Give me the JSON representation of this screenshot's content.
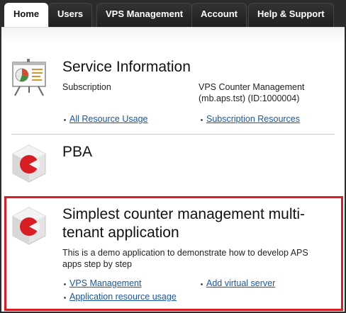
{
  "tabs": [
    {
      "label": "Home"
    },
    {
      "label": "Users"
    },
    {
      "label": "VPS Management"
    },
    {
      "label": "Account"
    },
    {
      "label": "Help & Support"
    }
  ],
  "service_info": {
    "title": "Service Information",
    "subscription_label": "Subscription",
    "subscription_value_line1": "VPS Counter Management",
    "subscription_value_line2": "(mb.aps.tst) (ID:1000004)",
    "links": [
      "All Resource Usage",
      "Subscription Resources"
    ]
  },
  "pba": {
    "title": "PBA"
  },
  "app": {
    "title_line1": "Simplest counter management multi-",
    "title_line2": "tenant application",
    "description_line1": "This is a demo application to demonstrate how to develop APS",
    "description_line2": "apps step by step",
    "links": [
      "VPS Management",
      "Application resource usage",
      "Add virtual server"
    ]
  },
  "colors": {
    "accent": "#d81e23",
    "link": "#1a56a8",
    "tab_bg": "#2b2b2b"
  },
  "icons": [
    "presentation-chart-icon",
    "parallels-cube-icon"
  ]
}
